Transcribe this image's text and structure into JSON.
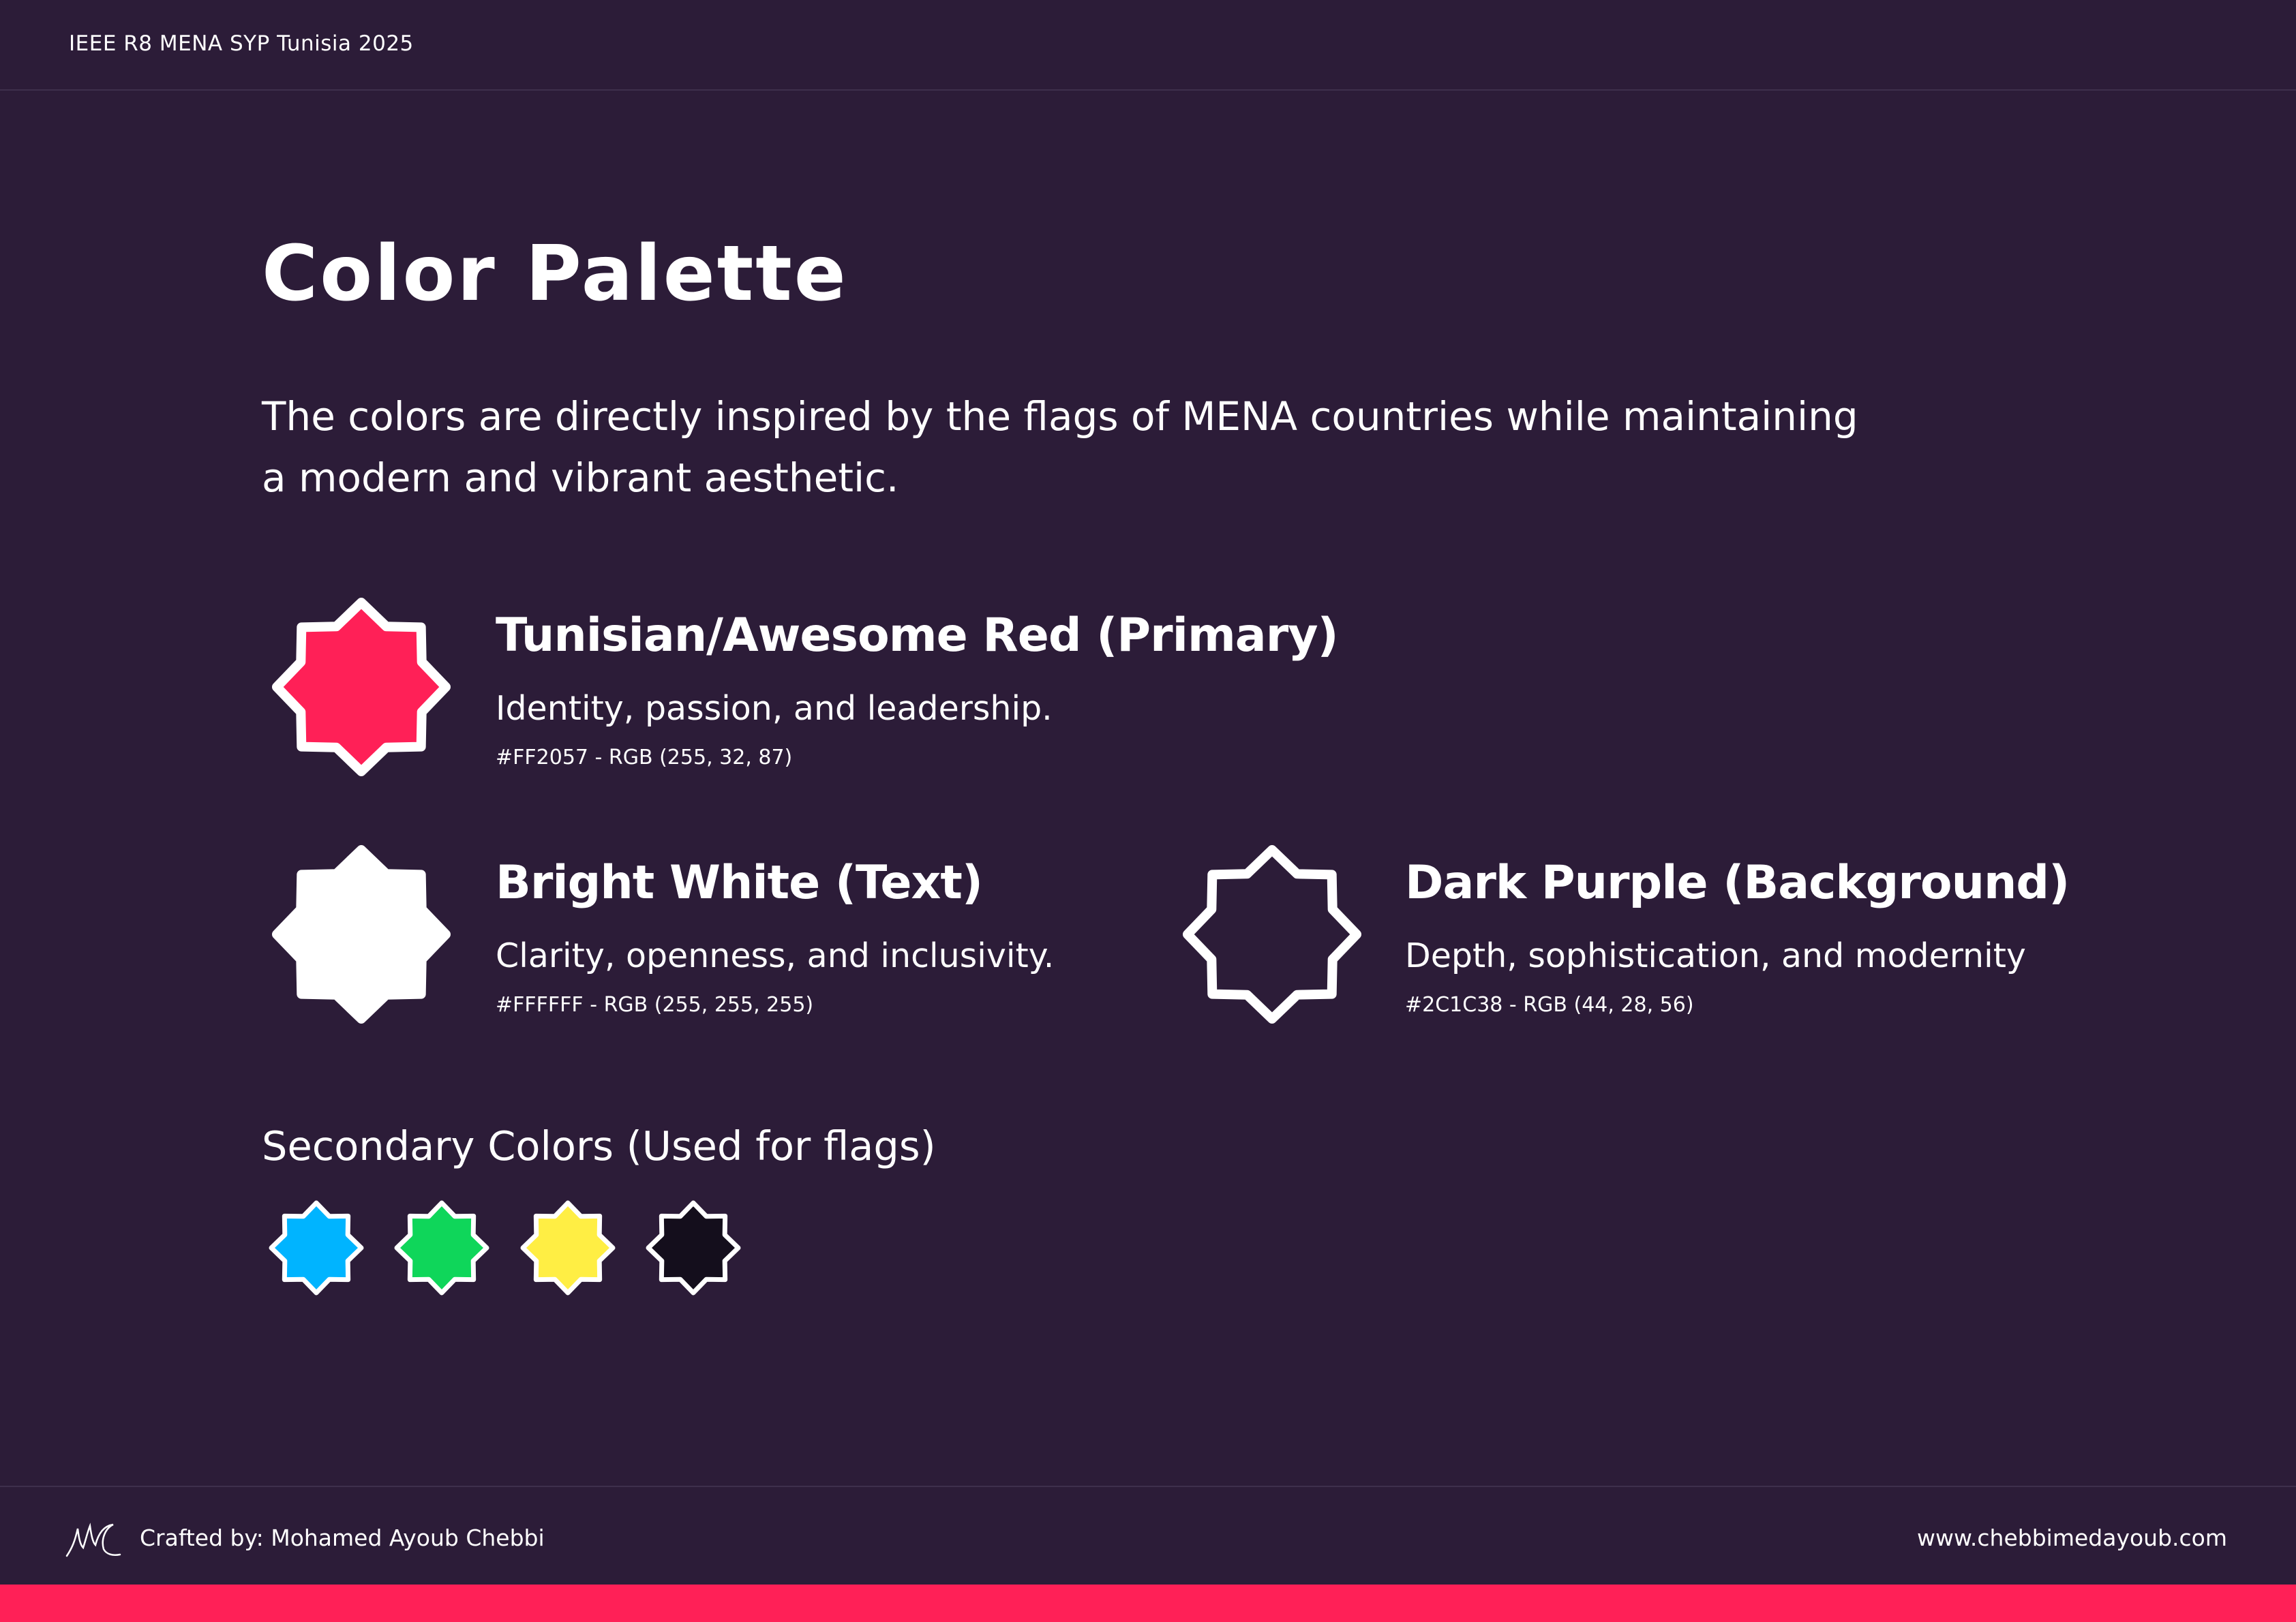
{
  "header": {
    "title": "IEEE R8 MENA SYP Tunisia 2025"
  },
  "page": {
    "title": "Color Palette",
    "intro_line1": "The colors are directly inspired by the flags of MENA countries while maintaining",
    "intro_line2": "a modern and vibrant aesthetic."
  },
  "colors": {
    "primary": {
      "name": "Tunisian/Awesome Red (Primary)",
      "description": "Identity, passion, and leadership.",
      "code": "#FF2057 - RGB (255, 32, 87)",
      "hex": "#FF2057"
    },
    "text": {
      "name": "Bright White (Text)",
      "description": "Clarity, openness, and inclusivity.",
      "code": "#FFFFFF - RGB (255, 255, 255)",
      "hex": "#FFFFFF"
    },
    "background": {
      "name": "Dark Purple (Background)",
      "description": "Depth, sophistication, and modernity",
      "code": "#2C1C38 - RGB (44, 28, 56)",
      "hex": "#2C1C38"
    }
  },
  "secondary": {
    "heading": "Secondary Colors (Used for flags)",
    "swatches": [
      {
        "icon": "blue-star-swatch",
        "hex": "#00B4FF"
      },
      {
        "icon": "green-star-swatch",
        "hex": "#0FD65A"
      },
      {
        "icon": "yellow-star-swatch",
        "hex": "#FFEE44"
      },
      {
        "icon": "black-star-swatch",
        "hex": "#140E1C"
      }
    ]
  },
  "footer": {
    "credit": "Crafted by: Mohamed Ayoub Chebbi",
    "website": "www.chebbimedayoub.com",
    "logo_icon": "signature-logo"
  },
  "accent_color": "#FF2057"
}
